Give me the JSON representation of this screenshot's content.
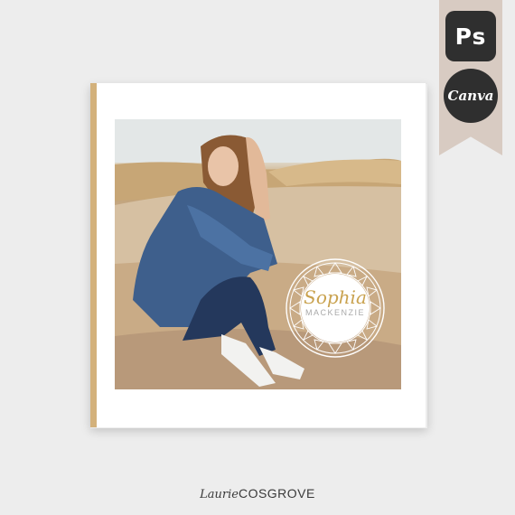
{
  "badges": {
    "photoshop": "Ps",
    "canva": "Canva"
  },
  "seal": {
    "first_name": "Sophia",
    "last_name": "MACKENZIE"
  },
  "brand": {
    "first": "Laurie",
    "last": "COSGROVE"
  },
  "colors": {
    "background": "#ededed",
    "ribbon": "#d8cbc2",
    "badge": "#2f2f2f",
    "spine": "#d3b17b",
    "gold": "#c9a24f"
  },
  "icons": [
    "photoshop-icon",
    "canva-icon",
    "seal-logo"
  ]
}
